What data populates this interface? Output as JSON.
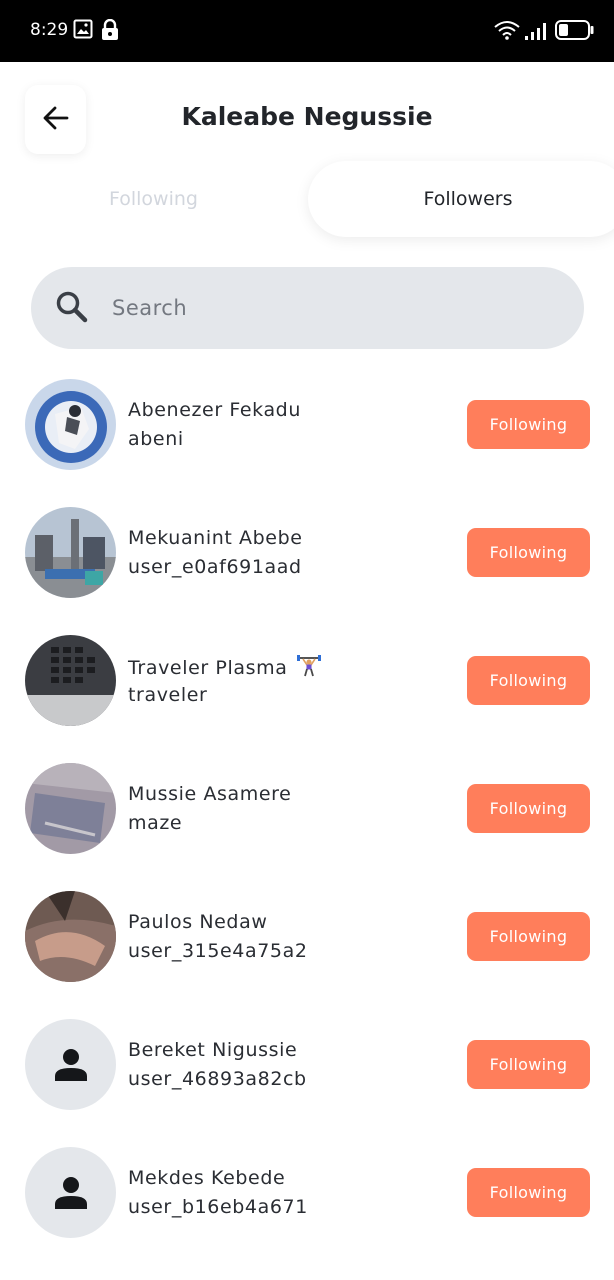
{
  "status_bar": {
    "time": "8:29",
    "icons": [
      "gallery-icon",
      "lock-icon",
      "wifi-icon",
      "signal-icon",
      "battery-icon"
    ]
  },
  "header": {
    "title": "Kaleabe Negussie",
    "back_icon": "arrow-left-icon"
  },
  "tabs": [
    {
      "label": "Following",
      "active": false
    },
    {
      "label": "Followers",
      "active": true
    }
  ],
  "search": {
    "placeholder": "Search",
    "value": "",
    "icon": "search-icon"
  },
  "followers": [
    {
      "name": "Abenezer Fekadu",
      "handle": "abeni",
      "button_label": "Following",
      "avatar": "photo"
    },
    {
      "name": "Mekuanint Abebe",
      "handle": "user_e0af691aad",
      "button_label": "Following",
      "avatar": "photo"
    },
    {
      "name": "Traveler Plasma",
      "name_emoji": "weightlifter-icon",
      "handle": "traveler",
      "button_label": "Following",
      "avatar": "photo"
    },
    {
      "name": "Mussie Asamere",
      "handle": "maze",
      "button_label": "Following",
      "avatar": "photo"
    },
    {
      "name": "Paulos Nedaw",
      "handle": "user_315e4a75a2",
      "button_label": "Following",
      "avatar": "photo"
    },
    {
      "name": "Bereket Nigussie",
      "handle": "user_46893a82cb",
      "button_label": "Following",
      "avatar": "default-person-icon"
    },
    {
      "name": "Mekdes Kebede",
      "handle": "user_b16eb4a671",
      "button_label": "Following",
      "avatar": "default-person-icon"
    }
  ],
  "colors": {
    "accent": "#ff7e5b",
    "search_bg": "#e4e7eb",
    "inactive_tab": "#d2d6dd",
    "title_text": "#22252a"
  }
}
